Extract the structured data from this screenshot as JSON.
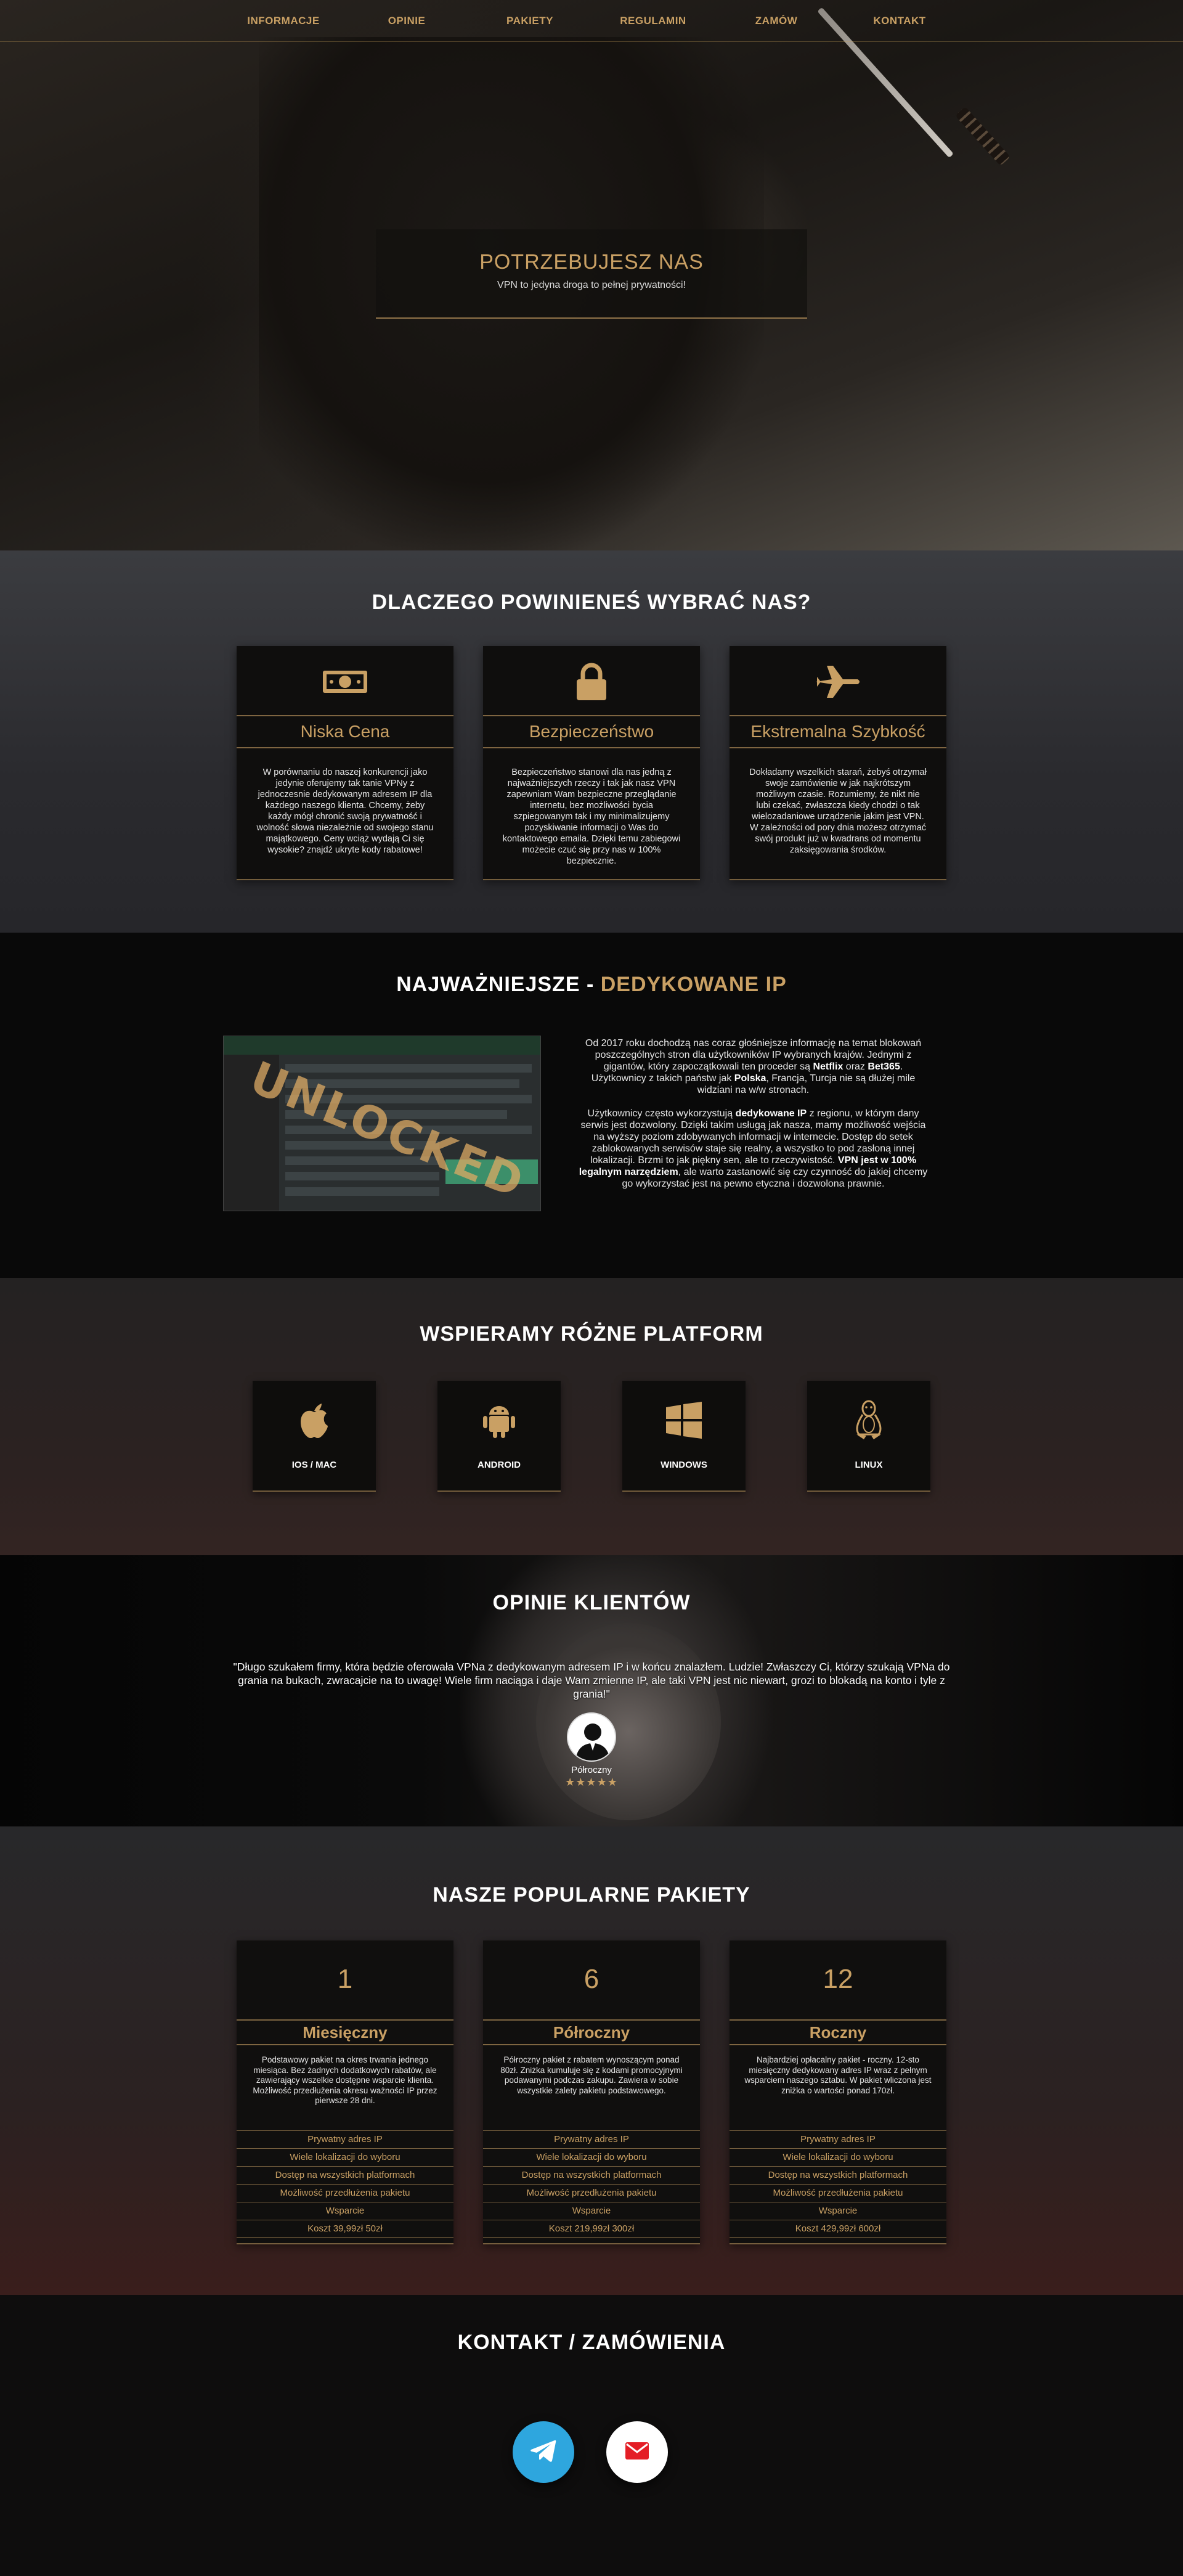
{
  "nav": {
    "items": [
      "INFORMACJE",
      "OPINIE",
      "PAKIETY",
      "REGULAMIN",
      "ZAMÓW",
      "KONTAKT"
    ]
  },
  "hero": {
    "title": "POTRZEBUJESZ NAS",
    "subtitle": "VPN to jedyna droga to pełnej prywatności!"
  },
  "why": {
    "title": "DLACZEGO POWINIENEŚ WYBRAĆ NAS?",
    "cards": [
      {
        "icon": "money-icon",
        "name": "Niska Cena",
        "text": "W porównaniu do naszej konkurencji jako jedynie oferujemy tak tanie VPNy z jednoczesnie dedykowanym adresem IP dla każdego naszego klienta. Chcemy, żeby każdy mógł chronić swoją prywatność i wolność słowa niezależnie od swojego stanu majątkowego. Ceny wciąż wydają Ci się wysokie? znajdź ukryte kody rabatowe!"
      },
      {
        "icon": "lock-icon",
        "name": "Bezpieczeństwo",
        "text": "Bezpieczeństwo stanowi dla nas jedną z najważniejszych rzeczy i tak jak nasz VPN zapewniam Wam bezpieczne przeglądanie internetu, bez możliwości bycia szpiegowanym tak i my minimalizujemy pozyskiwanie informacji o Was do kontaktowego emaila. Dzięki temu zabiegowi możecie czuć się przy nas w 100% bezpiecznie."
      },
      {
        "icon": "plane-icon",
        "name": "Ekstremalna Szybkość",
        "text": "Dokładamy wszelkich starań, żebyś otrzymał swoje zamówienie w jak najkrótszym możliwym czasie. Rozumiemy, że nikt nie lubi czekać, zwłaszcza kiedy chodzi o tak wielozadaniowe urządzenie jakim jest VPN. W zależności od pory dnia możesz otrzymać swój produkt już w kwadrans od momentu zaksięgowania środków."
      }
    ]
  },
  "dedicated": {
    "title_a": "NAJWAŻNIEJSZE - ",
    "title_b": "DEDYKOWANE IP",
    "image_stamp": "UNLOCKED",
    "p1_a": "Od 2017 roku dochodzą nas coraz głośniejsze informację na temat blokowań poszczególnych stron dla użytkowników IP wybranych krajów. Jednymi z gigantów, który zapoczątkowali ten proceder są ",
    "p1_b": "Netflix",
    "p1_c": " oraz ",
    "p1_d": "Bet365",
    "p1_e": ". Użytkownicy z takich państw jak ",
    "p1_f": "Polska",
    "p1_g": ", Francja, Turcja nie są dłużej mile widziani na w/w stronach.",
    "p2_a": "Użytkownicy często wykorzystują ",
    "p2_b": "dedykowane IP",
    "p2_c": " z regionu, w którym dany serwis jest dozwolony. Dzięki takim usługą jak nasza, mamy możliwość wejścia na wyższy poziom zdobywanych informacji w internecie. Dostęp do setek zablokowanych serwisów staje się realny, a wszystko to pod zasłoną innej lokalizacji. Brzmi to jak piękny sen, ale to rzeczywistość. ",
    "p2_d": "VPN jest w 100% legalnym narzędziem",
    "p2_e": ", ale warto zastanowić się czy czynność do jakiej chcemy go wykorzystać jest na pewno etyczna i dozwolona prawnie."
  },
  "platforms": {
    "title": "WSPIERAMY RÓŻNE PLATFORM",
    "items": [
      {
        "icon": "apple-icon",
        "label": "IOS / MAC"
      },
      {
        "icon": "android-icon",
        "label": "ANDROID"
      },
      {
        "icon": "windows-icon",
        "label": "WINDOWS"
      },
      {
        "icon": "linux-icon",
        "label": "LINUX"
      }
    ]
  },
  "opinions": {
    "title": "OPINIE KLIENTÓW",
    "quote": "\"Długo szukałem firmy, która będzie oferowała VPNa z dedykowanym adresem IP i w końcu znalazłem. Ludzie! Zwłaszczy Ci, którzy szukają VPNa do grania na bukach, zwracajcie na to uwagę! Wiele firm naciąga i daje Wam zmienne IP, ale taki VPN jest nic niewart, grozi to blokadą na konto i tyle z grania!\"",
    "name": "Półroczny",
    "stars": "★★★★★",
    "rating": 5
  },
  "packages": {
    "title": "NASZE POPULARNE PAKIETY",
    "cards": [
      {
        "num": "1",
        "name": "Miesięczny",
        "desc": "Podstawowy pakiet na okres trwania jednego miesiąca. Bez żadnych dodatkowych rabatów, ale zawierający wszelkie dostępne wsparcie klienta. Możliwość przedłużenia okresu ważności IP przez pierwsze 28 dni.",
        "features": [
          "Prywatny adres IP",
          "Wiele lokalizacji do wyboru",
          "Dostęp na wszystkich platformach",
          "Możliwość przedłużenia pakietu",
          "Wsparcie",
          "Koszt 39,99zł 50zł"
        ]
      },
      {
        "num": "6",
        "name": "Półroczny",
        "desc": "Półroczny pakiet z rabatem wynoszącym ponad 80zł. Zniżka kumuluje się z kodami promocyjnymi podawanymi podczas zakupu. Zawiera w sobie wszystkie zalety pakietu podstawowego.",
        "features": [
          "Prywatny adres IP",
          "Wiele lokalizacji do wyboru",
          "Dostęp na wszystkich platformach",
          "Możliwość przedłużenia pakietu",
          "Wsparcie",
          "Koszt 219,99zł 300zł"
        ]
      },
      {
        "num": "12",
        "name": "Roczny",
        "desc": "Najbardziej opłacalny pakiet - roczny. 12-sto miesięczny dedykowany adres IP wraz z pełnym wsparciem naszego sztabu. W pakiet wliczona jest zniżka o wartości ponad 170zł.",
        "features": [
          "Prywatny adres IP",
          "Wiele lokalizacji do wyboru",
          "Dostęp na wszystkich platformach",
          "Możliwość przedłużenia pakietu",
          "Wsparcie",
          "Koszt 429,99zł 600zł"
        ]
      }
    ]
  },
  "contact": {
    "title": "KONTAKT / ZAMÓWIENIA",
    "buttons": [
      {
        "icon": "telegram-icon",
        "color": "#2ea6de"
      },
      {
        "icon": "mail-icon",
        "color": "#ffffff"
      }
    ]
  },
  "colors": {
    "accent": "#c9a064",
    "background": "#111111",
    "card": "#0f0e0d"
  }
}
